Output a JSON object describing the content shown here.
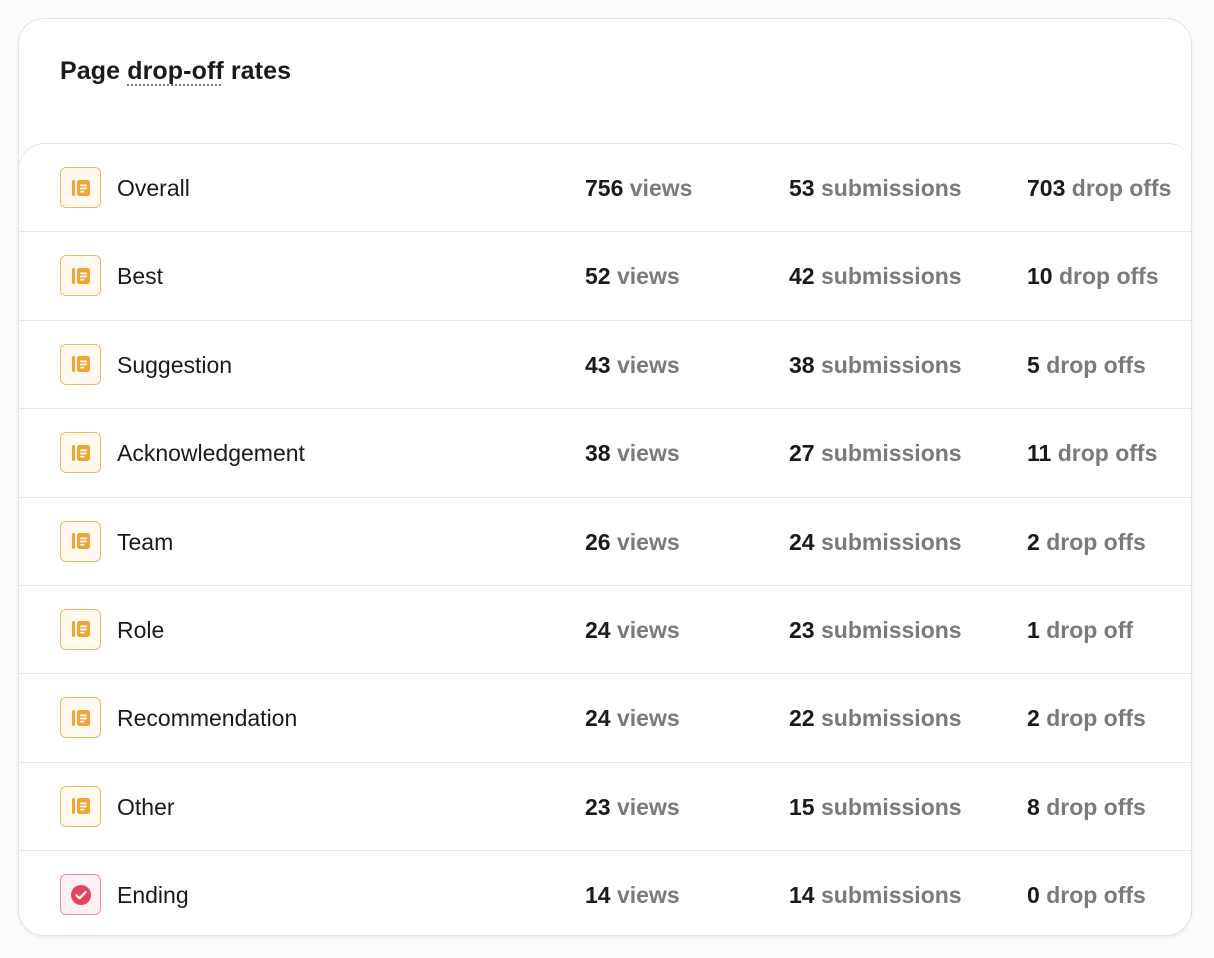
{
  "card": {
    "title_prefix": "Page ",
    "title_term": "drop-off",
    "title_suffix": " rates"
  },
  "icons": {
    "page": "page-form-icon",
    "ending": "check-circle-icon"
  },
  "colors": {
    "page_icon": "#f0a43a",
    "ending_icon": "#e5445f",
    "unit_text": "#7a7a7a"
  },
  "rows": [
    {
      "name": "Overall",
      "icon": "page",
      "views": "756",
      "views_unit": "views",
      "submissions": "53",
      "submissions_unit": "submissions",
      "drop_offs": "703",
      "drop_offs_unit": "drop offs"
    },
    {
      "name": "Best",
      "icon": "page",
      "views": "52",
      "views_unit": "views",
      "submissions": "42",
      "submissions_unit": "submissions",
      "drop_offs": "10",
      "drop_offs_unit": "drop offs"
    },
    {
      "name": "Suggestion",
      "icon": "page",
      "views": "43",
      "views_unit": "views",
      "submissions": "38",
      "submissions_unit": "submissions",
      "drop_offs": "5",
      "drop_offs_unit": "drop offs"
    },
    {
      "name": "Acknowledgement",
      "icon": "page",
      "views": "38",
      "views_unit": "views",
      "submissions": "27",
      "submissions_unit": "submissions",
      "drop_offs": "11",
      "drop_offs_unit": "drop offs"
    },
    {
      "name": "Team",
      "icon": "page",
      "views": "26",
      "views_unit": "views",
      "submissions": "24",
      "submissions_unit": "submissions",
      "drop_offs": "2",
      "drop_offs_unit": "drop offs"
    },
    {
      "name": "Role",
      "icon": "page",
      "views": "24",
      "views_unit": "views",
      "submissions": "23",
      "submissions_unit": "submissions",
      "drop_offs": "1",
      "drop_offs_unit": "drop off"
    },
    {
      "name": "Recommendation",
      "icon": "page",
      "views": "24",
      "views_unit": "views",
      "submissions": "22",
      "submissions_unit": "submissions",
      "drop_offs": "2",
      "drop_offs_unit": "drop offs"
    },
    {
      "name": "Other",
      "icon": "page",
      "views": "23",
      "views_unit": "views",
      "submissions": "15",
      "submissions_unit": "submissions",
      "drop_offs": "8",
      "drop_offs_unit": "drop offs"
    },
    {
      "name": "Ending",
      "icon": "ending",
      "views": "14",
      "views_unit": "views",
      "submissions": "14",
      "submissions_unit": "submissions",
      "drop_offs": "0",
      "drop_offs_unit": "drop offs"
    }
  ]
}
